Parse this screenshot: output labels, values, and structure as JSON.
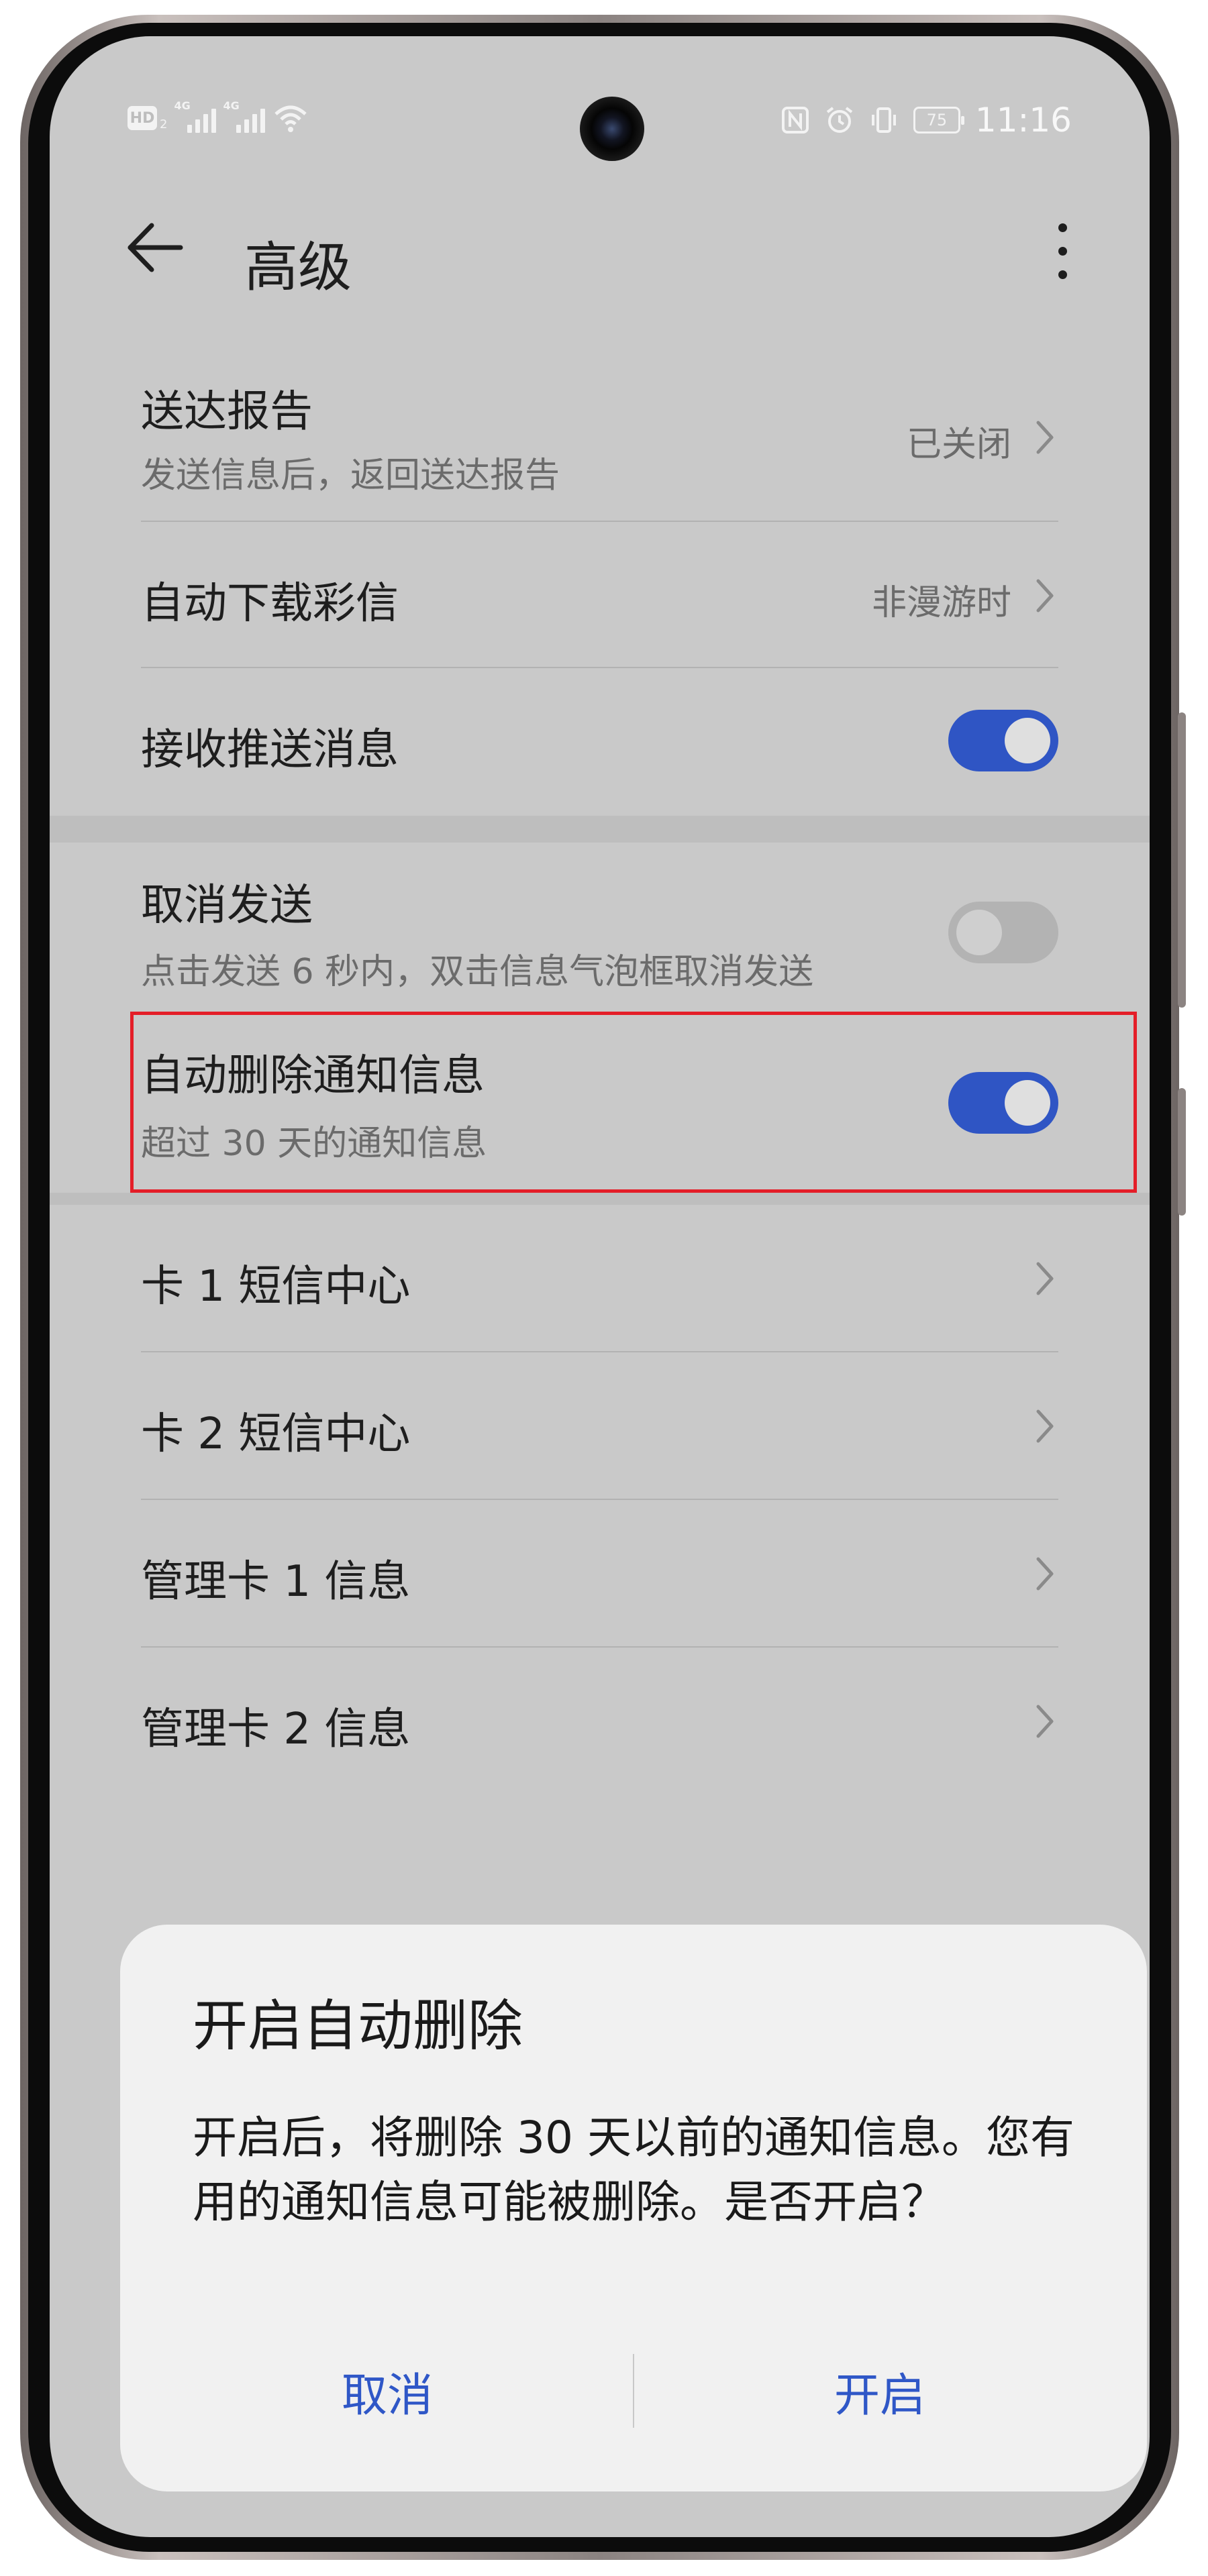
{
  "status_bar": {
    "hd_label": "HD",
    "sim_number": "2",
    "network1": "4G",
    "network2": "4G",
    "battery_level": "75",
    "time": "11:16"
  },
  "header": {
    "title": "高级"
  },
  "settings": {
    "delivery_report": {
      "title": "送达报告",
      "subtitle": "发送信息后，返回送达报告",
      "value": "已关闭"
    },
    "auto_download_mms": {
      "title": "自动下载彩信",
      "value": "非漫游时"
    },
    "receive_push": {
      "title": "接收推送消息",
      "enabled": true
    },
    "cancel_send": {
      "title": "取消发送",
      "subtitle": "点击发送 6 秒内，双击信息气泡框取消发送",
      "enabled": false
    },
    "auto_delete_notifications": {
      "title": "自动删除通知信息",
      "subtitle": "超过 30 天的通知信息",
      "enabled": true
    },
    "card1_sms_center": {
      "title": "卡 1 短信中心"
    },
    "card2_sms_center": {
      "title": "卡 2 短信中心"
    },
    "manage_card1": {
      "title": "管理卡 1 信息"
    },
    "manage_card2": {
      "title": "管理卡 2 信息"
    }
  },
  "dialog": {
    "title": "开启自动删除",
    "body": "开启后，将删除 30 天以前的通知信息。您有用的通知信息可能被删除。是否开启？",
    "cancel_label": "取消",
    "confirm_label": "开启"
  },
  "colors": {
    "accent": "#2f55c4",
    "highlight_border": "#e41e28",
    "screen_background": "#c9c9c9",
    "dialog_background": "#f1f1f1"
  }
}
